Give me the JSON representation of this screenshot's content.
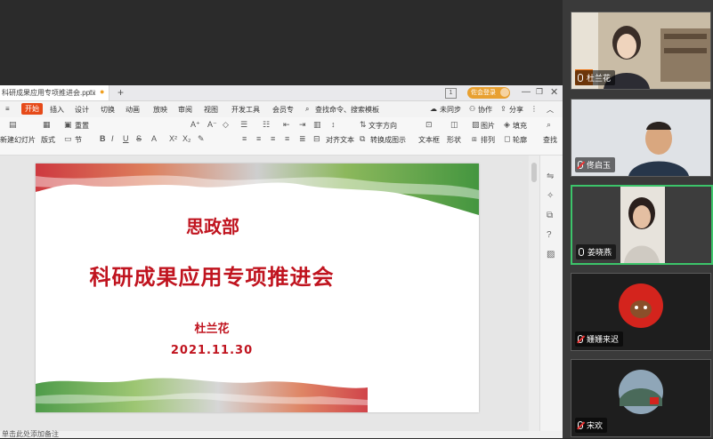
{
  "wps": {
    "doc_tab_title": "科研成果应用专项推进会.pptx",
    "new_tab": "+",
    "window_count": "1",
    "meeting_pill": "佐会登录",
    "menu": {
      "expand": "≡",
      "start": "开始",
      "insert": "插入",
      "design": "设计",
      "transition": "切换",
      "animation": "动画",
      "slideshow": "放映",
      "review": "审阅",
      "view": "视图",
      "devtools": "开发工具",
      "member": "会员专",
      "search": "查找命令、搜索模板",
      "unsynced": "未同步",
      "collaborate": "协作",
      "share": "分享"
    },
    "ribbon": {
      "new_slide": "新建幻灯片",
      "layout": "版式",
      "section": "节",
      "reset": "重置",
      "textbox": "文本框",
      "shape": "形状",
      "arrange": "排列",
      "picture": "图片",
      "fill": "填充",
      "outline": "轮廓",
      "find": "查找",
      "text_direction": "文字方向",
      "align_text": "对齐文本",
      "convert_smartart": "转换成图示"
    },
    "notes_placeholder": "单击此处添加备注"
  },
  "slide": {
    "title1": "思政部",
    "title2": "科研成果应用专项推进会",
    "author": "杜兰花",
    "date": "2021.11.30"
  },
  "participants": [
    {
      "name": "杜兰花",
      "mic": "on"
    },
    {
      "name": "佟启玉",
      "mic": "muted"
    },
    {
      "name": "姜晓燕",
      "mic": "on"
    },
    {
      "name": "姗姗来迟",
      "mic": "muted"
    },
    {
      "name": "宋欢",
      "mic": "muted"
    }
  ],
  "colors": {
    "accent_orange": "#e8a030",
    "slide_red": "#c0141f",
    "active_speaker": "#3cc46a"
  }
}
